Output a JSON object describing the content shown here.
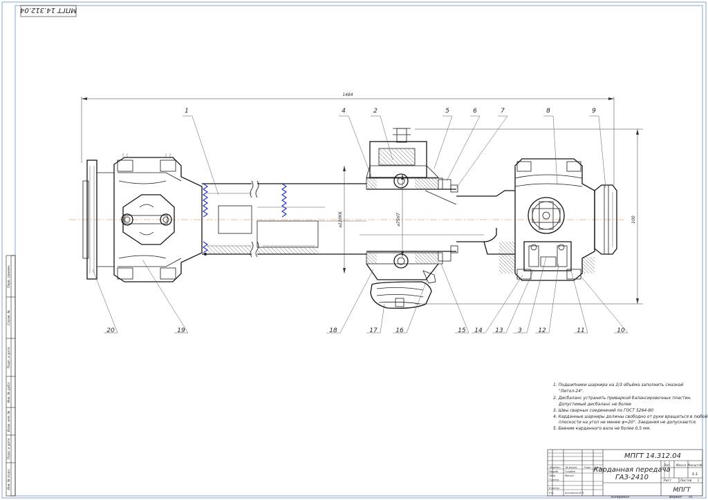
{
  "stamp_top_left": "МПГТ 14.312.04",
  "dimensions": {
    "overall_length": "1484",
    "height": "100",
    "diam_inner": "⌀120К6",
    "diam_outer": "⌀75Н7"
  },
  "callouts_top": [
    "1",
    "4",
    "2",
    "5",
    "6",
    "7",
    "8",
    "9"
  ],
  "callouts_bottom": [
    "20",
    "19",
    "18",
    "17",
    "16",
    "15",
    "14",
    "13",
    "3",
    "12",
    "11",
    "10"
  ],
  "notes": [
    "1. Подшипники шарнира на 2/3 объёма заполнить смазкой",
    "\"Литол-24\".",
    "2. Дисбаланс устранить приваркой балансировочных пластин.",
    "Допустимый дисбаланс не более",
    "3. Швы сварных соединений по ГОСТ 5264-80",
    "4. Карданные шарниры должны свободно от руки вращаться в любой",
    "плоскости на угол не менее φ=20°. Заедания не допускаются.",
    "5. Биение карданного вала не более 0,5 мм."
  ],
  "left_strip": [
    "Перв. примен.",
    "Справ. №",
    "Подп. и дата",
    "Инв. № дубл.",
    "Взам. инв. №",
    "Подп. и дата",
    "Инв. № подл."
  ],
  "title_block": {
    "designation": "МПГТ 14.312.04",
    "name_line1": "Карданная передача",
    "name_line2": "ГАЗ-2410",
    "org": "МПГТ",
    "col_lit": "Лит.",
    "col_mass": "Масса",
    "col_scale": "Масштаб",
    "scale": "1:1",
    "sheet": "Лист",
    "sheets": "Листов",
    "sheets_count": "1",
    "roles": [
      "Изм.",
      "Лист",
      "№ докум.",
      "Подп.",
      "Дата"
    ],
    "rows": [
      {
        "role": "Разраб.",
        "name": "Голубев"
      },
      {
        "role": "Пров.",
        "name": "Маскат"
      },
      {
        "role": "Т.контр.",
        "name": ""
      },
      {
        "role": "Н.контр.",
        "name": ""
      },
      {
        "role": "Утв.",
        "name": "Антоненко В.Л."
      }
    ],
    "copied": "Копировал",
    "format": "Формат",
    "format_value": "А1"
  }
}
